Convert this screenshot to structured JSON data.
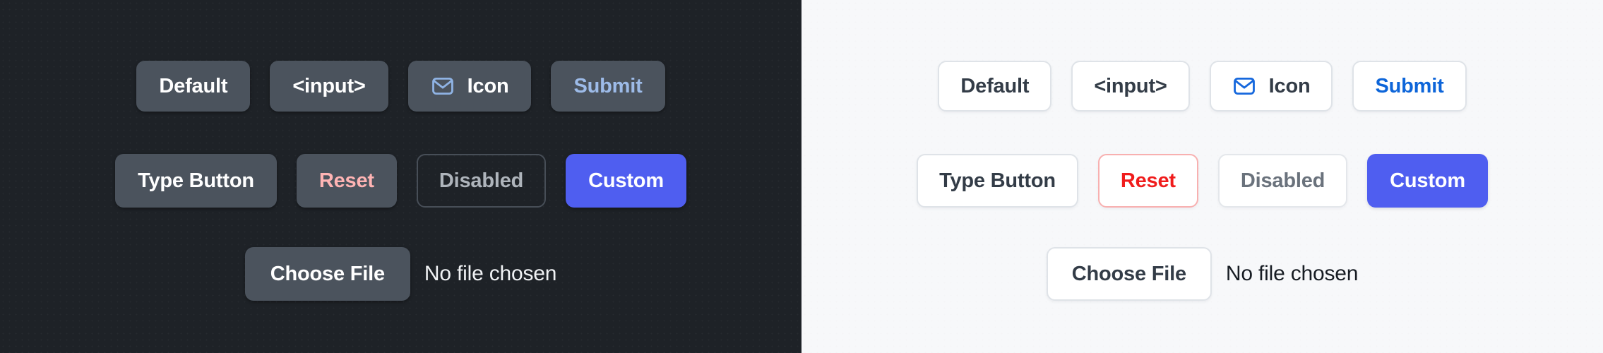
{
  "theme_colors": {
    "dark_panel_bg": "#1e2227",
    "light_panel_bg": "#f7f8fa",
    "dark_button_bg": "#4b535d",
    "light_button_bg": "#ffffff",
    "custom_blue": "#4f5ef0",
    "dark_submit_text": "#9dbbe8",
    "light_submit_text": "#0d65d9",
    "dark_reset_text": "#ffb4b4",
    "light_reset_text": "#f01c1c",
    "light_reset_border": "#f8b0b0",
    "dark_icon_stroke": "#8fb3e4",
    "light_icon_stroke": "#1668dd",
    "dark_disabled_text": "#aeb4bb",
    "light_disabled_text": "#6a727c"
  },
  "panels": {
    "dark": {
      "row1": [
        {
          "label": "Default",
          "variant": "solid"
        },
        {
          "label": "<input>",
          "variant": "solid"
        },
        {
          "label": "Icon",
          "variant": "solid",
          "icon": "envelope-icon"
        },
        {
          "label": "Submit",
          "variant": "solid",
          "accent": "blue"
        }
      ],
      "row2": [
        {
          "label": "Type Button",
          "variant": "solid"
        },
        {
          "label": "Reset",
          "variant": "solid",
          "accent": "red"
        },
        {
          "label": "Disabled",
          "variant": "outline",
          "disabled": true
        },
        {
          "label": "Custom",
          "variant": "custom"
        }
      ],
      "file": {
        "button_label": "Choose File",
        "status_text": "No file chosen"
      }
    },
    "light": {
      "row1": [
        {
          "label": "Default",
          "variant": "solid"
        },
        {
          "label": "<input>",
          "variant": "solid"
        },
        {
          "label": "Icon",
          "variant": "solid",
          "icon": "envelope-icon"
        },
        {
          "label": "Submit",
          "variant": "solid",
          "accent": "blue"
        }
      ],
      "row2": [
        {
          "label": "Type Button",
          "variant": "solid"
        },
        {
          "label": "Reset",
          "variant": "solid",
          "accent": "red"
        },
        {
          "label": "Disabled",
          "variant": "outline",
          "disabled": true
        },
        {
          "label": "Custom",
          "variant": "custom"
        }
      ],
      "file": {
        "button_label": "Choose File",
        "status_text": "No file chosen"
      }
    }
  }
}
